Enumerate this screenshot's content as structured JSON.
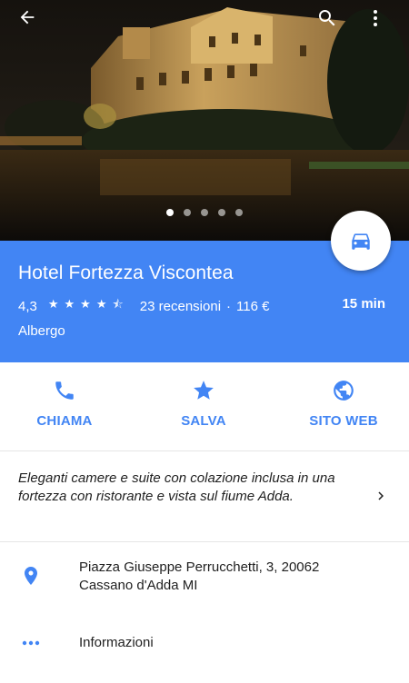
{
  "toolbar": {
    "back_icon": "arrow-back-icon",
    "search_icon": "search-icon",
    "more_icon": "more-vert-icon"
  },
  "photos": {
    "count": 5,
    "active_index": 0
  },
  "place": {
    "name": "Hotel Fortezza Viscontea",
    "rating": "4,3",
    "rating_value": 4.3,
    "reviews": "23 recensioni",
    "separator": "·",
    "price": "116 €",
    "category": "Albergo",
    "drive_time": "15 min"
  },
  "directions_icon": "car-icon",
  "actions": [
    {
      "label": "CHIAMA",
      "icon": "phone-icon"
    },
    {
      "label": "SALVA",
      "icon": "star-icon"
    },
    {
      "label": "SITO WEB",
      "icon": "globe-icon"
    }
  ],
  "description": "Eleganti camere e suite con colazione inclusa in una fortezza con ristorante e vista sul fiume Adda.",
  "address": {
    "line1": "Piazza Giuseppe Perrucchetti, 3, 20062",
    "line2": "Cassano d'Adda MI"
  },
  "more_info": {
    "label": "Informazioni"
  },
  "colors": {
    "accent": "#4285f4",
    "text": "#212121",
    "divider": "#e5e5e5"
  }
}
